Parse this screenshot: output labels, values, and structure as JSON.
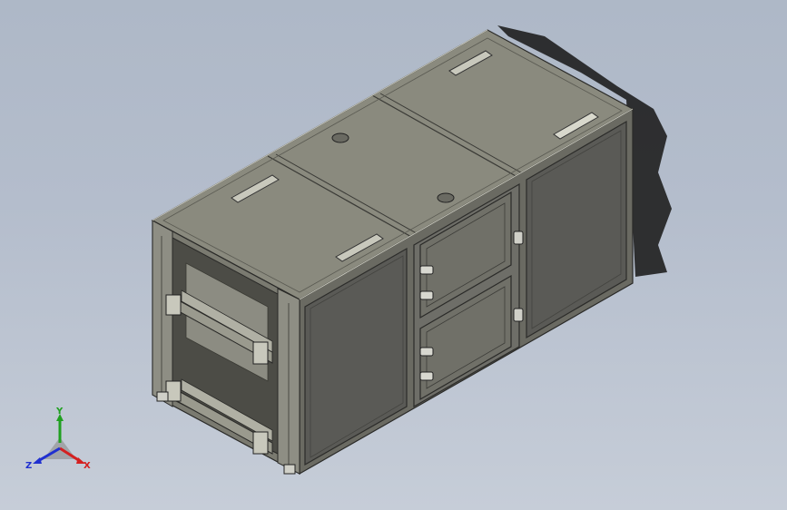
{
  "viewport": {
    "background_top": "#aeb8c7",
    "background_bottom": "#c6cdd8"
  },
  "model": {
    "icon": "enclosure-3d-model",
    "colors": {
      "top_face": "#8a8a7e",
      "front_face": "#5c5c58",
      "side_face": "#6c6c64",
      "edge": "#2a2a28",
      "shadow": "#1c1c1c"
    }
  },
  "triad": {
    "x_label": "X",
    "y_label": "Y",
    "z_label": "Z",
    "x_color": "#d42020",
    "y_color": "#20a020",
    "z_color": "#2030d0"
  }
}
